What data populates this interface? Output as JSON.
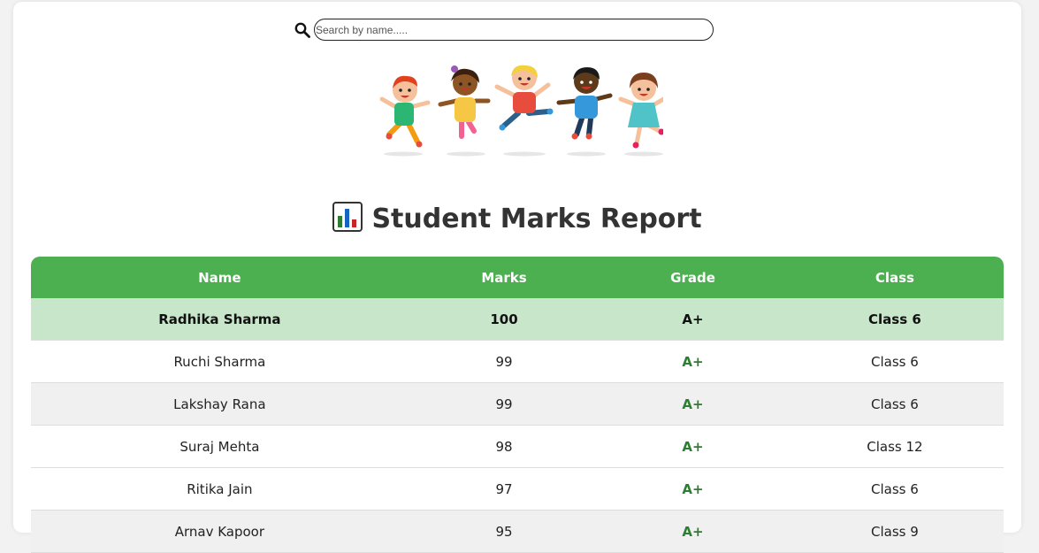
{
  "search": {
    "placeholder": "Search by name....."
  },
  "heading": {
    "icon": "bar-chart-icon",
    "title": "Student Marks Report"
  },
  "colors": {
    "header": "#4caf50",
    "top_row": "#c8e6c9",
    "grade": "#2e7d32"
  },
  "table": {
    "columns": [
      "Name",
      "Marks",
      "Grade",
      "Class"
    ],
    "rows": [
      {
        "name": "Radhika Sharma",
        "marks": "100",
        "grade": "A+",
        "class": "Class 6"
      },
      {
        "name": "Ruchi Sharma",
        "marks": "99",
        "grade": "A+",
        "class": "Class 6"
      },
      {
        "name": "Lakshay Rana",
        "marks": "99",
        "grade": "A+",
        "class": "Class 6"
      },
      {
        "name": "Suraj Mehta",
        "marks": "98",
        "grade": "A+",
        "class": "Class 12"
      },
      {
        "name": "Ritika Jain",
        "marks": "97",
        "grade": "A+",
        "class": "Class 6"
      },
      {
        "name": "Arnav Kapoor",
        "marks": "95",
        "grade": "A+",
        "class": "Class 9"
      }
    ]
  }
}
